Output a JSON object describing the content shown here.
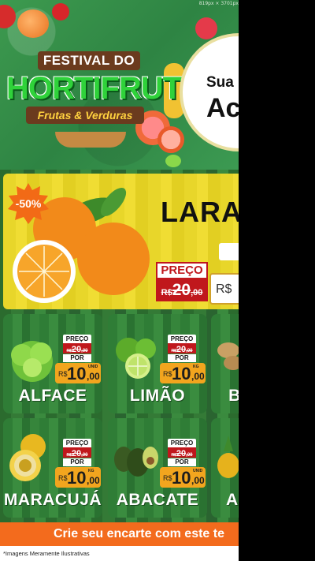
{
  "dimensions_label": "819px × 3701px",
  "header": {
    "banner_top": "FESTIVAL DO",
    "banner_main": "HORTIFRUTI",
    "banner_sub": "Frutas & Verduras",
    "circle_line1": "Sua",
    "circle_line2": "Ac"
  },
  "featured": {
    "discount": "-50%",
    "name": "LARA",
    "price_label": "PREÇO",
    "old_price": {
      "currency": "R$",
      "int": "20",
      "dec": ",00"
    },
    "new_price": {
      "currency": "R$"
    }
  },
  "products": [
    {
      "name": "ALFACE",
      "preco_label": "PREÇO",
      "old_currency": "R$",
      "old_int": "20",
      "old_dec": ",00",
      "por_label": "POR",
      "currency": "R$",
      "new_int": "10",
      "new_dec": ",00",
      "unit": "UNID"
    },
    {
      "name": "LIMÃO",
      "preco_label": "PREÇO",
      "old_currency": "R$",
      "old_int": "20",
      "old_dec": ",00",
      "por_label": "POR",
      "currency": "R$",
      "new_int": "10",
      "new_dec": ",00",
      "unit": "KG"
    },
    {
      "name": "B"
    },
    {
      "name": "MARACUJÁ",
      "preco_label": "PREÇO",
      "old_currency": "R$",
      "old_int": "20",
      "old_dec": ",00",
      "por_label": "POR",
      "currency": "R$",
      "new_int": "10",
      "new_dec": ",00",
      "unit": "KG"
    },
    {
      "name": "ABACATE",
      "preco_label": "PREÇO",
      "old_currency": "R$",
      "old_int": "20",
      "old_dec": ",00",
      "por_label": "POR",
      "currency": "R$",
      "new_int": "10",
      "new_dec": ",00",
      "unit": "UNID"
    },
    {
      "name": "AI"
    }
  ],
  "cta_text": "Crie seu encarte com este te",
  "footnote": "*Imagens Meramente Ilustrativas",
  "colors": {
    "brand_green": "#2fd23a",
    "price_red": "#c0171c",
    "price_orange": "#f2a51e",
    "cta_orange": "#f36b1d",
    "featured_yellow": "#e8d62a"
  }
}
